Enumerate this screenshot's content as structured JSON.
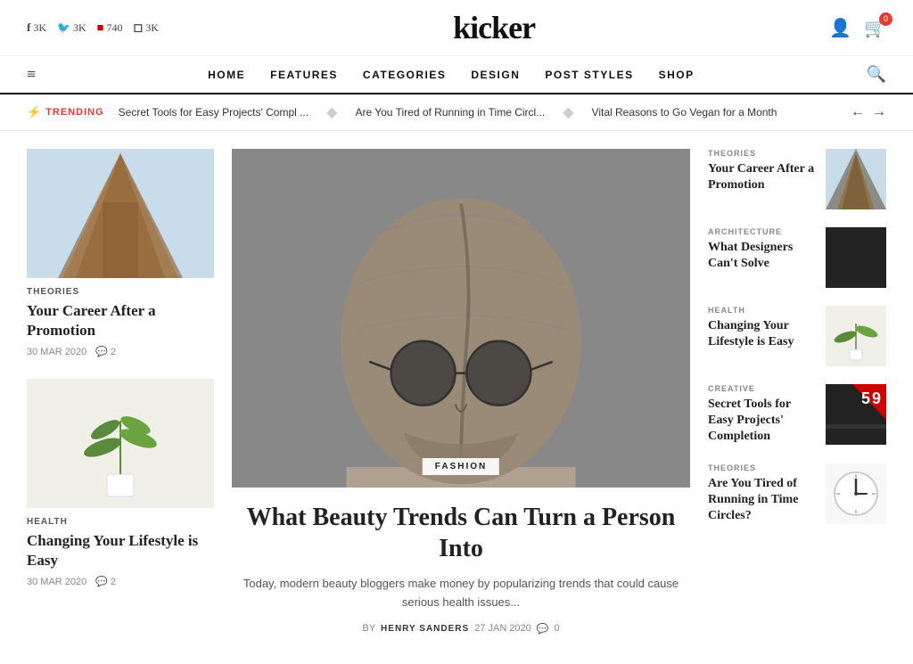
{
  "site": {
    "title": "kicker"
  },
  "topbar": {
    "social": [
      {
        "icon": "f",
        "label": "3K",
        "name": "facebook"
      },
      {
        "icon": "𝕏",
        "label": "3K",
        "name": "twitter"
      },
      {
        "icon": "▶",
        "label": "740",
        "name": "youtube"
      },
      {
        "icon": "◻",
        "label": "3K",
        "name": "instagram"
      }
    ],
    "cart_count": "0"
  },
  "nav": {
    "menu_icon": "≡",
    "links": [
      "HOME",
      "FEATURES",
      "CATEGORIES",
      "DESIGN",
      "POST STYLES",
      "SHOP"
    ],
    "search_icon": "🔍"
  },
  "trending": {
    "label": "TRENDING",
    "bolt": "⚡",
    "items": [
      "Secret Tools for Easy Projects' Compl ...",
      "Are You Tired of Running in Time Circl...",
      "Vital Reasons to Go Vegan for a Month"
    ],
    "prev": "←",
    "next": "→"
  },
  "left_cards": [
    {
      "category": "THEORIES",
      "title": "Your Career After a Promotion",
      "date": "30 MAR 2020",
      "comments": "2",
      "img_type": "arch"
    },
    {
      "category": "HEALTH",
      "title": "Changing Your Lifestyle is Easy",
      "date": "30 MAR 2020",
      "comments": "2",
      "img_type": "plant"
    }
  ],
  "hero": {
    "category": "FASHION",
    "title": "What Beauty Trends Can Turn a Person Into",
    "excerpt": "Today, modern beauty bloggers make money by popularizing trends that could cause serious health issues...",
    "author_prefix": "BY",
    "author": "HENRY SANDERS",
    "date": "27 JAN 2020",
    "comment_icon": "💬",
    "comments": "0"
  },
  "right_cards": [
    {
      "category": "THEORIES",
      "title": "Your Career After a Promotion",
      "img_type": "arch"
    },
    {
      "category": "ARCHITECTURE",
      "title": "What Designers Can't Solve",
      "img_type": "black"
    },
    {
      "category": "HEALTH",
      "title": "Changing Your Lifestyle is Easy",
      "img_type": "plant"
    },
    {
      "category": "CREATIVE",
      "title": "Secret Tools for Easy Projects' Completion",
      "img_type": "red"
    },
    {
      "category": "THEORIES",
      "title": "Are You Tired of Running in Time Circles?",
      "img_type": "clock"
    }
  ]
}
